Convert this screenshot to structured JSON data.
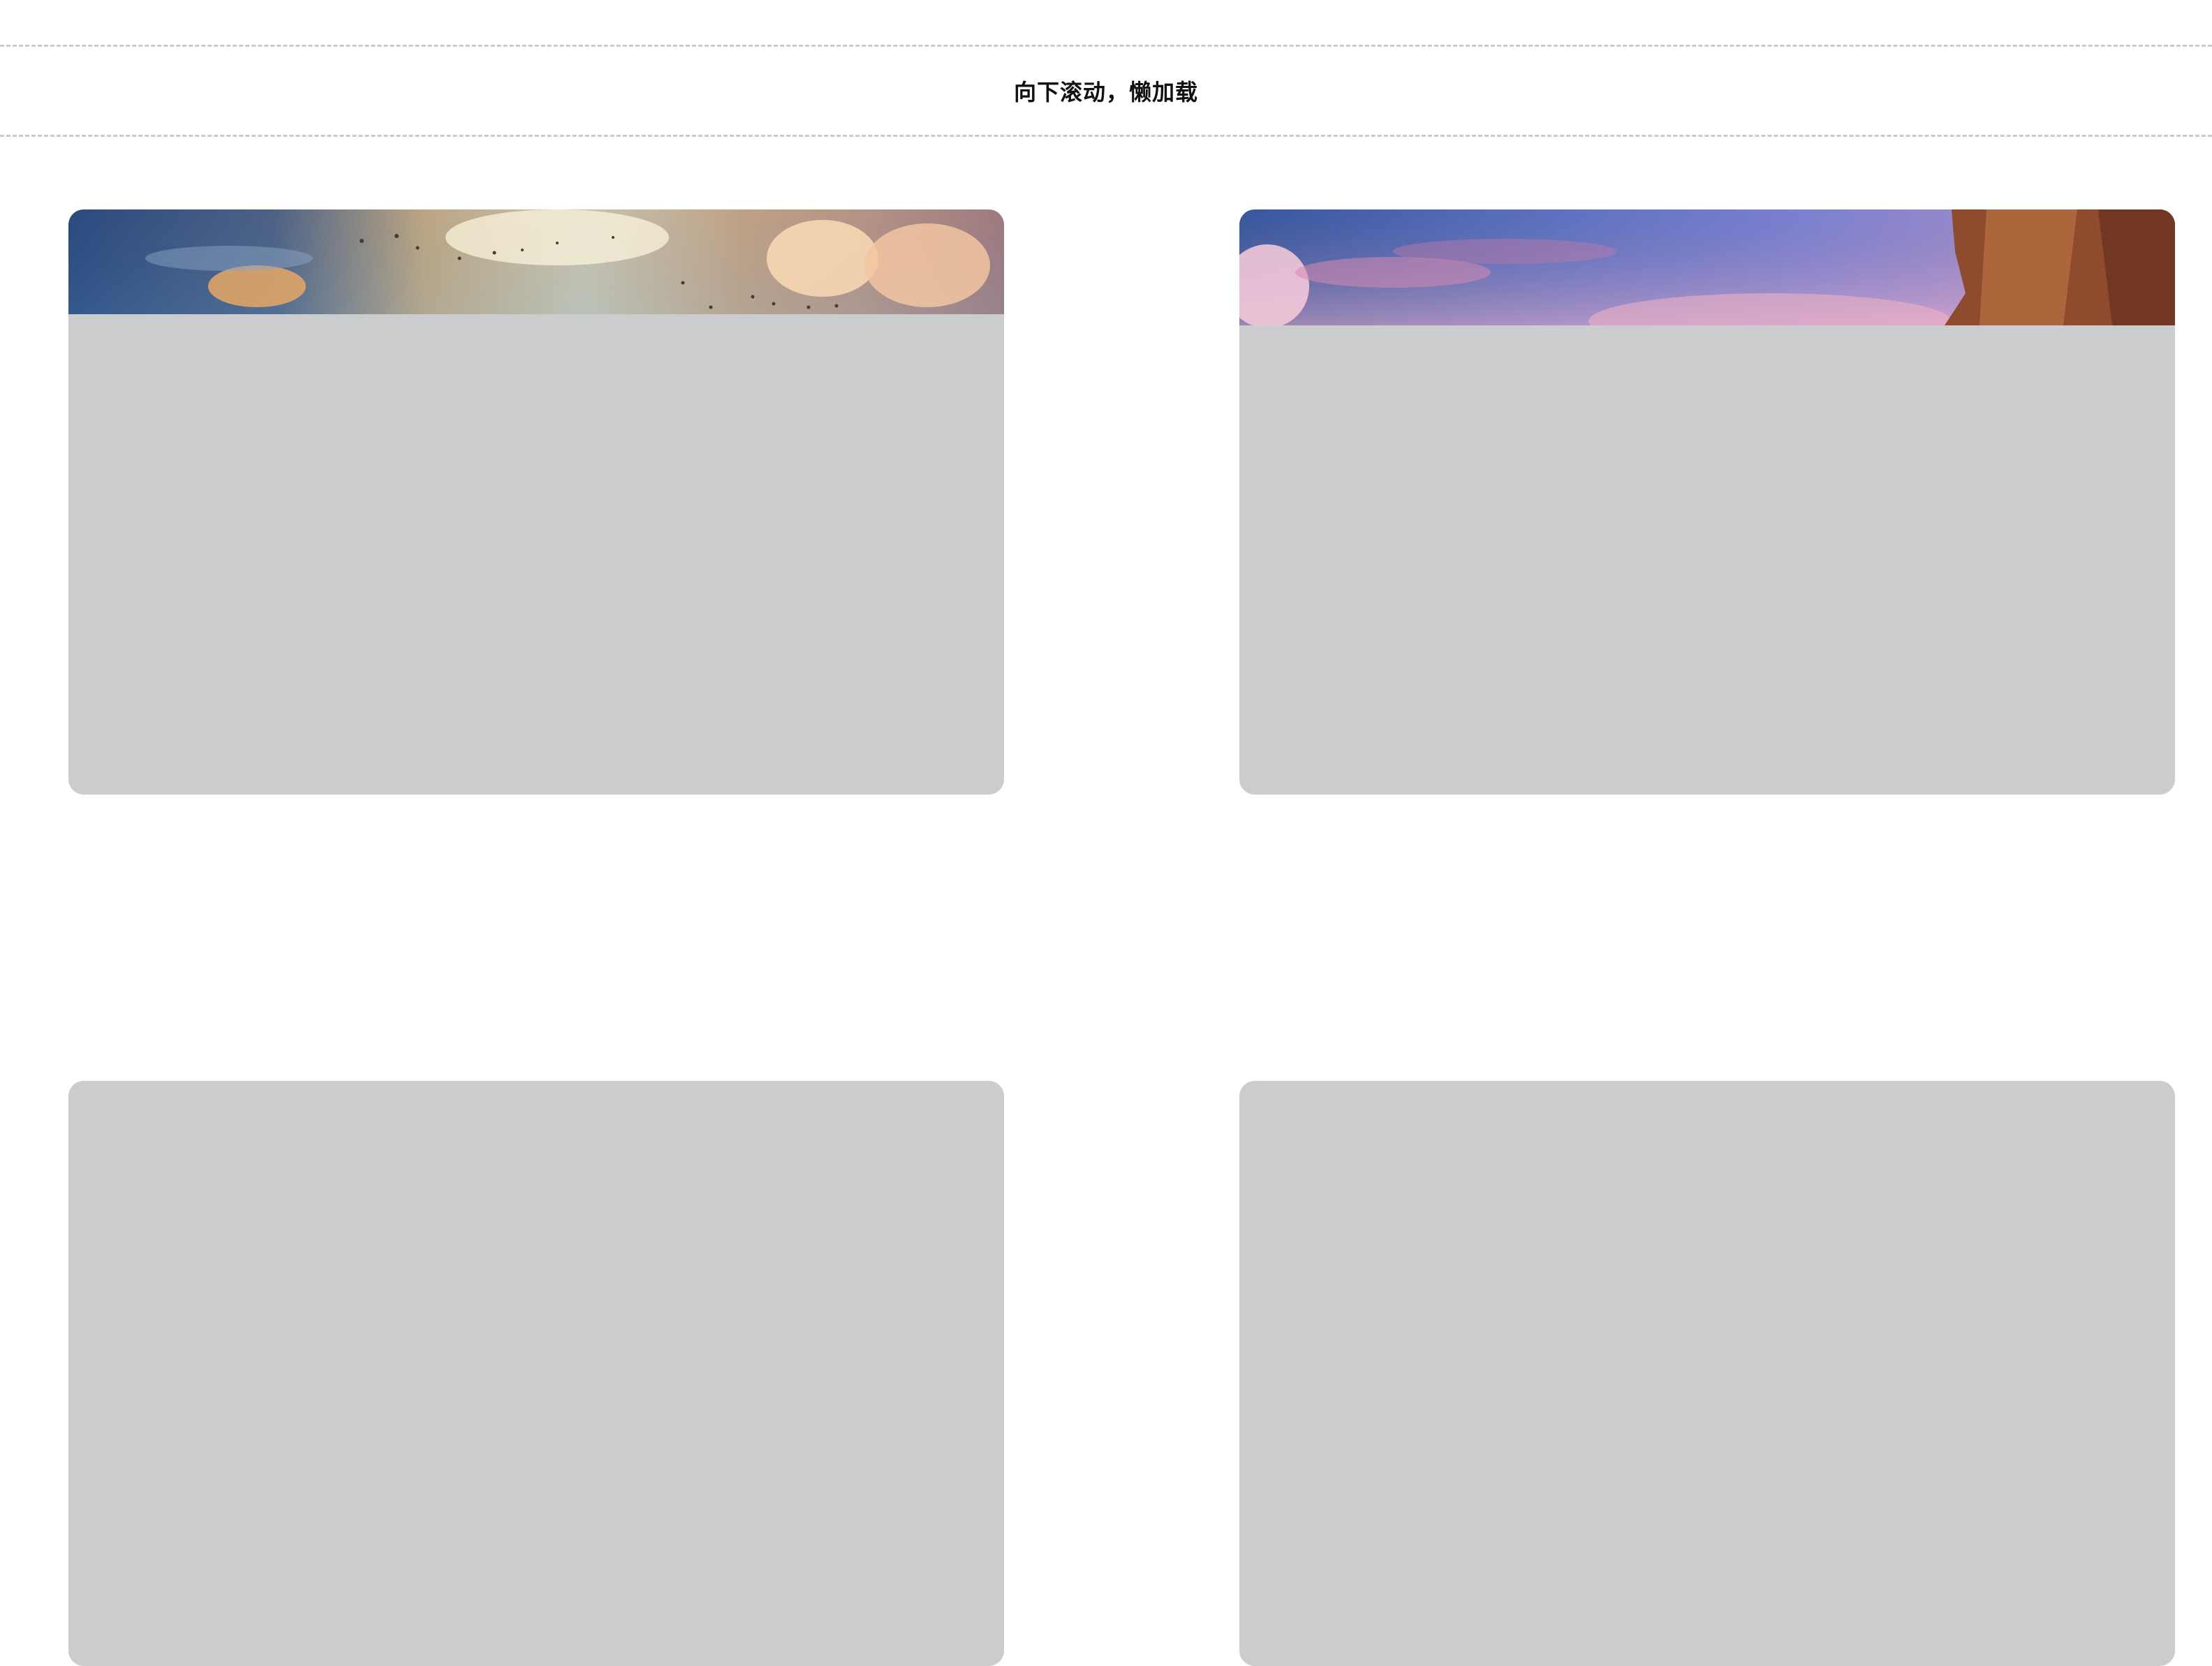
{
  "header": {
    "title": "向下滚动，懒加载"
  },
  "cards": [
    {
      "image": "sunset-sky-with-birds",
      "state": "partially-loaded"
    },
    {
      "image": "dusk-sky-with-cliff",
      "state": "partially-loaded"
    },
    {
      "image": "placeholder",
      "state": "not-loaded"
    },
    {
      "image": "placeholder",
      "state": "not-loaded"
    }
  ],
  "colors": {
    "placeholder": "#cbcccd",
    "divider": "#c9cacc",
    "background": "#ffffff"
  }
}
